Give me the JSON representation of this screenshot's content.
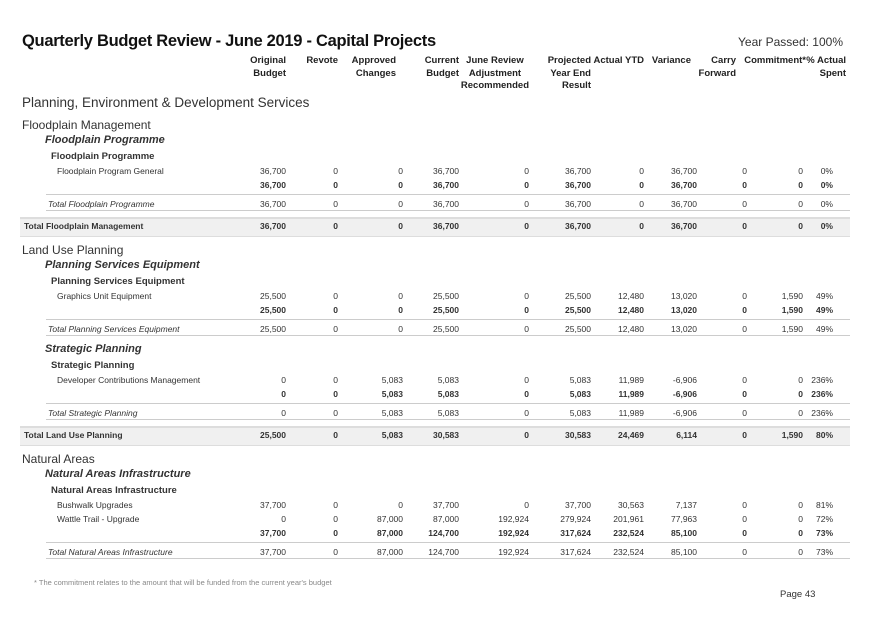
{
  "title": "Quarterly Budget Review - June 2019 - Capital Projects",
  "year_passed": "Year Passed: 100%",
  "columns": [
    "Original\nBudget",
    "Revote",
    "Approved\nChanges",
    "Current\nBudget",
    "June Review\nAdjustment\nRecommended",
    "Projected\nYear End\nResult",
    "Actual YTD",
    "Variance",
    "Carry\nForward",
    "Commitment*",
    "% Actual\nSpent"
  ],
  "directorate": "Planning, Environment & Development Services",
  "rows": [
    {
      "type": "group",
      "label": "Floodplain Management"
    },
    {
      "type": "sub",
      "label": "Floodplain Programme"
    },
    {
      "type": "sub2",
      "label": "Floodplain Programme"
    },
    {
      "type": "item",
      "label": "Floodplain Program General",
      "values": [
        "36,700",
        "0",
        "0",
        "36,700",
        "0",
        "36,700",
        "0",
        "36,700",
        "0",
        "0",
        "0%"
      ]
    },
    {
      "type": "subtotal",
      "label": "",
      "values": [
        "36,700",
        "0",
        "0",
        "36,700",
        "0",
        "36,700",
        "0",
        "36,700",
        "0",
        "0",
        "0%"
      ]
    },
    {
      "type": "progtotal",
      "label": "Total Floodplain Programme",
      "values": [
        "36,700",
        "0",
        "0",
        "36,700",
        "0",
        "36,700",
        "0",
        "36,700",
        "0",
        "0",
        "0%"
      ]
    },
    {
      "type": "grouptotal",
      "label": "Total Floodplain Management",
      "values": [
        "36,700",
        "0",
        "0",
        "36,700",
        "0",
        "36,700",
        "0",
        "36,700",
        "0",
        "0",
        "0%"
      ]
    },
    {
      "type": "group",
      "label": "Land Use Planning"
    },
    {
      "type": "sub",
      "label": "Planning Services Equipment"
    },
    {
      "type": "sub2",
      "label": "Planning Services Equipment"
    },
    {
      "type": "item",
      "label": "Graphics Unit Equipment",
      "values": [
        "25,500",
        "0",
        "0",
        "25,500",
        "0",
        "25,500",
        "12,480",
        "13,020",
        "0",
        "1,590",
        "49%"
      ]
    },
    {
      "type": "subtotal",
      "label": "",
      "values": [
        "25,500",
        "0",
        "0",
        "25,500",
        "0",
        "25,500",
        "12,480",
        "13,020",
        "0",
        "1,590",
        "49%"
      ]
    },
    {
      "type": "progtotal",
      "label": "Total Planning Services Equipment",
      "values": [
        "25,500",
        "0",
        "0",
        "25,500",
        "0",
        "25,500",
        "12,480",
        "13,020",
        "0",
        "1,590",
        "49%"
      ]
    },
    {
      "type": "sub",
      "label": "Strategic Planning"
    },
    {
      "type": "sub2",
      "label": "Strategic Planning"
    },
    {
      "type": "item",
      "label": "Developer Contributions Management",
      "values": [
        "0",
        "0",
        "5,083",
        "5,083",
        "0",
        "5,083",
        "11,989",
        "-6,906",
        "0",
        "0",
        "236%"
      ]
    },
    {
      "type": "subtotal",
      "label": "",
      "values": [
        "0",
        "0",
        "5,083",
        "5,083",
        "0",
        "5,083",
        "11,989",
        "-6,906",
        "0",
        "0",
        "236%"
      ]
    },
    {
      "type": "progtotal",
      "label": "Total Strategic Planning",
      "values": [
        "0",
        "0",
        "5,083",
        "5,083",
        "0",
        "5,083",
        "11,989",
        "-6,906",
        "0",
        "0",
        "236%"
      ]
    },
    {
      "type": "grouptotal",
      "label": "Total Land Use Planning",
      "values": [
        "25,500",
        "0",
        "5,083",
        "30,583",
        "0",
        "30,583",
        "24,469",
        "6,114",
        "0",
        "1,590",
        "80%"
      ]
    },
    {
      "type": "group",
      "label": "Natural Areas"
    },
    {
      "type": "sub",
      "label": "Natural Areas Infrastructure"
    },
    {
      "type": "sub2",
      "label": "Natural Areas Infrastructure"
    },
    {
      "type": "item",
      "label": "Bushwalk Upgrades",
      "values": [
        "37,700",
        "0",
        "0",
        "37,700",
        "0",
        "37,700",
        "30,563",
        "7,137",
        "0",
        "0",
        "81%"
      ]
    },
    {
      "type": "item",
      "label": "Wattle Trail - Upgrade",
      "values": [
        "0",
        "0",
        "87,000",
        "87,000",
        "192,924",
        "279,924",
        "201,961",
        "77,963",
        "0",
        "0",
        "72%"
      ]
    },
    {
      "type": "subtotal",
      "label": "",
      "values": [
        "37,700",
        "0",
        "87,000",
        "124,700",
        "192,924",
        "317,624",
        "232,524",
        "85,100",
        "0",
        "0",
        "73%"
      ]
    },
    {
      "type": "progtotal",
      "label": "Total Natural Areas Infrastructure",
      "values": [
        "37,700",
        "0",
        "87,000",
        "124,700",
        "192,924",
        "317,624",
        "232,524",
        "85,100",
        "0",
        "0",
        "73%"
      ]
    }
  ],
  "footnote": "* The commitment relates to the amount that will be funded from the current year's budget",
  "page": "Page 43"
}
